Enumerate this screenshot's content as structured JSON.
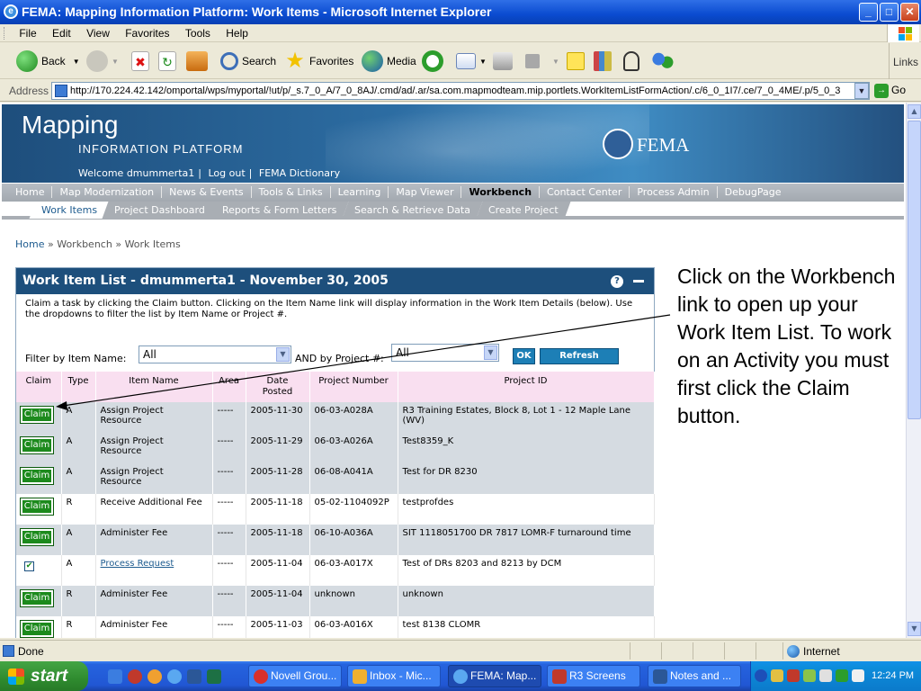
{
  "window": {
    "title": "FEMA: Mapping Information Platform: Work Items - Microsoft Internet Explorer"
  },
  "menu": [
    "File",
    "Edit",
    "View",
    "Favorites",
    "Tools",
    "Help"
  ],
  "toolbar": {
    "back": "Back",
    "search": "Search",
    "favorites": "Favorites",
    "media": "Media",
    "links": "Links"
  },
  "address": {
    "label": "Address",
    "url": "http://170.224.42.142/omportal/wps/myportal/!ut/p/_s.7_0_A/7_0_8AJ/.cmd/ad/.ar/sa.com.mapmodteam.mip.portlets.WorkItemListFormAction/.c/6_0_1I7/.ce/7_0_4ME/.p/5_0_3",
    "go": "Go"
  },
  "banner": {
    "brand_main": "Mapping",
    "brand_sub": "INFORMATION PLATFORM",
    "agency": "FEMA",
    "welcome": "Welcome dmummerta1",
    "logout": "Log out",
    "dictionary": "FEMA Dictionary"
  },
  "nav_main": [
    "Home",
    "Map Modernization",
    "News & Events",
    "Tools & Links",
    "Learning",
    "Map Viewer",
    "Workbench",
    "Contact Center",
    "Process Admin",
    "DebugPage"
  ],
  "nav_sub": [
    "Work Items",
    "Project Dashboard",
    "Reports & Form Letters",
    "Search & Retrieve Data",
    "Create Project"
  ],
  "breadcrumb": {
    "home": "Home",
    "sep": "»",
    "workbench": "Workbench",
    "current": "Work Items"
  },
  "panel": {
    "title": "Work Item List - dmummerta1 - November 30, 2005",
    "help": "?",
    "description": "Claim a task by clicking the Claim button. Clicking on the Item Name link will display information in the Work Item Details (below). Use the dropdowns to filter the list by Item Name or Project #.",
    "filter_item_label": "Filter by Item Name:",
    "filter_item_value": "All",
    "filter_project_label": "AND by Project #:",
    "filter_project_value": "All",
    "ok": "OK",
    "refresh": "Refresh"
  },
  "table": {
    "headers": [
      "Claim",
      "Type",
      "Item Name",
      "Area",
      "Date Posted",
      "Project Number",
      "Project ID"
    ],
    "claim_label": "Claim",
    "rows": [
      {
        "claim": "button",
        "type": "A",
        "item": "Assign Project Resource",
        "area": "-----",
        "date": "2005-11-30",
        "number": "06-03-A028A",
        "pid": "R3 Training Estates, Block 8, Lot 1 - 12 Maple Lane (WV)"
      },
      {
        "claim": "button",
        "type": "A",
        "item": "Assign Project Resource",
        "area": "-----",
        "date": "2005-11-29",
        "number": "06-03-A026A",
        "pid": "Test8359_K"
      },
      {
        "claim": "button",
        "type": "A",
        "item": "Assign Project Resource",
        "area": "-----",
        "date": "2005-11-28",
        "number": "06-08-A041A",
        "pid": "Test for DR 8230"
      },
      {
        "claim": "button",
        "type": "R",
        "item": "Receive Additional Fee",
        "area": "-----",
        "date": "2005-11-18",
        "number": "05-02-1104092P",
        "pid": "testprofdes"
      },
      {
        "claim": "button",
        "type": "A",
        "item": "Administer Fee",
        "area": "-----",
        "date": "2005-11-18",
        "number": "06-10-A036A",
        "pid": "SIT 1118051700 DR 7817 LOMR-F turnaround time"
      },
      {
        "claim": "checked",
        "type": "A",
        "item": "Process Request",
        "area": "-----",
        "date": "2005-11-04",
        "number": "06-03-A017X",
        "pid": "Test of DRs 8203 and 8213 by DCM"
      },
      {
        "claim": "button",
        "type": "R",
        "item": "Administer Fee",
        "area": "-----",
        "date": "2005-11-04",
        "number": "unknown",
        "pid": "unknown"
      },
      {
        "claim": "button",
        "type": "R",
        "item": "Administer Fee",
        "area": "-----",
        "date": "2005-11-03",
        "number": "06-03-A016X",
        "pid": "test 8138 CLOMR"
      }
    ]
  },
  "annotation": "Click on the Workbench link to open up your Work Item List. To work on an Activity you must first click the Claim button.",
  "status": {
    "text": "Done",
    "zone": "Internet"
  },
  "taskbar": {
    "start": "start",
    "tasks": [
      "Novell Grou...",
      "Inbox - Mic...",
      "FEMA: Map...",
      "R3 Screens",
      "Notes and ..."
    ],
    "clock": "12:24 PM"
  },
  "colors": {
    "banner": "#1e4e7c",
    "claim_button": "#1c8a1c",
    "panel_header": "#1d4f7c",
    "table_header": "#f9dff0",
    "row_shaded": "#d5dbe1"
  }
}
